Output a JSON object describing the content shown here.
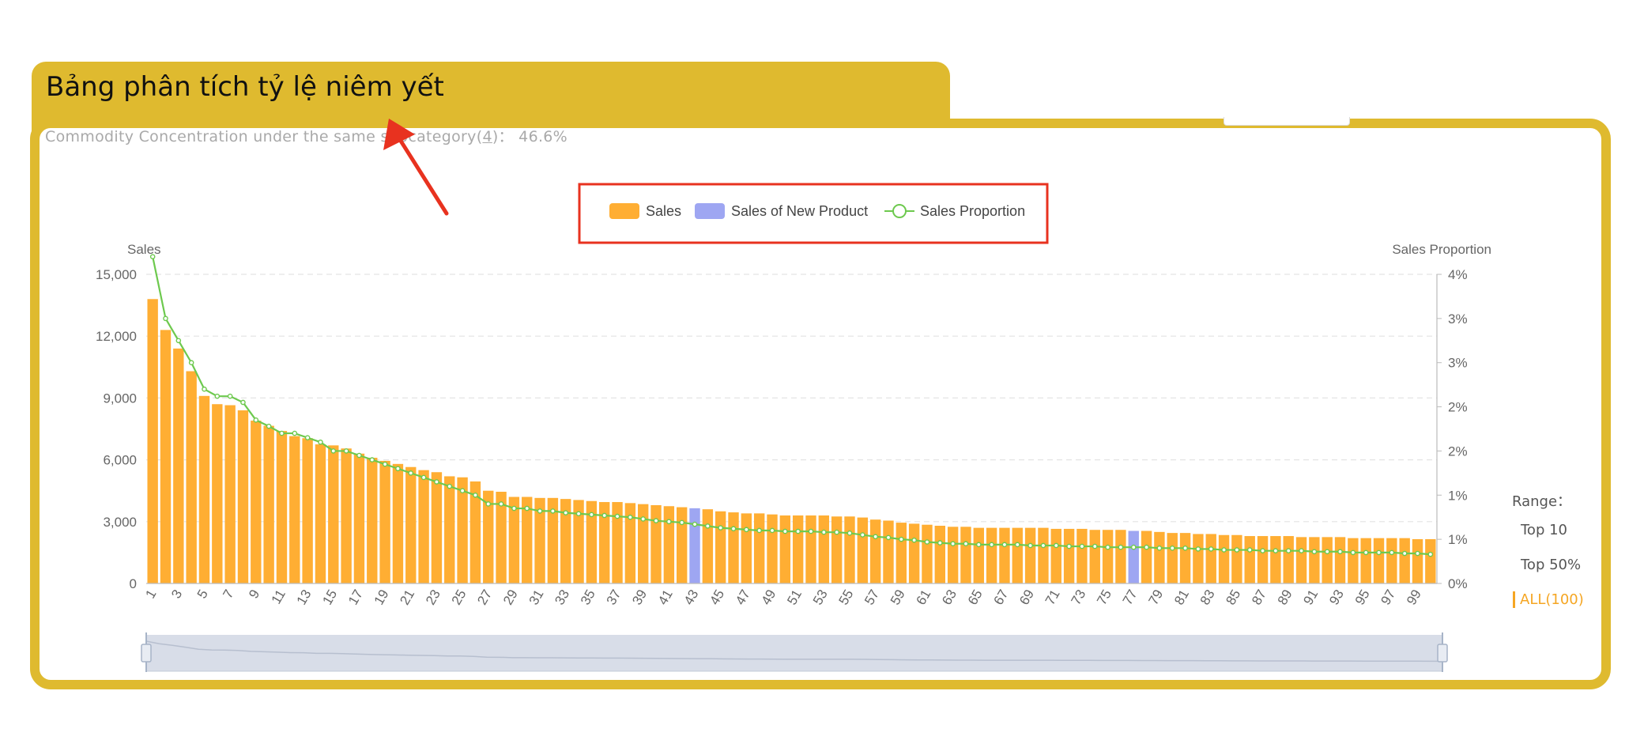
{
  "header": {
    "title": "Bảng phân tích tỷ lệ niêm yết",
    "subtitle_prefix": "Commodity Concentration under the same subcategory(",
    "subtitle_count": "4",
    "subtitle_suffix": ")：  46.6%"
  },
  "range": {
    "label": "Range：",
    "options": [
      "Top 10",
      "Top 50%",
      "ALL(100)"
    ],
    "active": "ALL(100)"
  },
  "colors": {
    "sales": "#ffae33",
    "new_product": "#9ea6f2",
    "proportion": "#6dc94e",
    "annotation": "#e8321f",
    "accent": "#dfba2f"
  },
  "chart_data": {
    "type": "bar",
    "legend": [
      "Sales",
      "Sales of New Product",
      "Sales Proportion"
    ],
    "ylabel_left": "Sales",
    "ylabel_right": "Sales Proportion",
    "yticks_left": [
      "0",
      "3,000",
      "6,000",
      "9,000",
      "12,000",
      "15,000"
    ],
    "yticks_right": [
      "0%",
      "1%",
      "1%",
      "2%",
      "2%",
      "3%",
      "3%",
      "4%"
    ],
    "ylim_left": [
      0,
      15000
    ],
    "ylim_right": [
      0,
      3.5
    ],
    "x_tick_labels": [
      "1",
      "3",
      "5",
      "7",
      "9",
      "11",
      "13",
      "15",
      "17",
      "19",
      "21",
      "23",
      "25",
      "27",
      "29",
      "31",
      "33",
      "35",
      "37",
      "39",
      "41",
      "43",
      "45",
      "47",
      "49",
      "51",
      "53",
      "55",
      "57",
      "59",
      "61",
      "63",
      "65",
      "67",
      "69",
      "71",
      "73",
      "75",
      "77",
      "79",
      "81",
      "83",
      "85",
      "87",
      "89",
      "91",
      "93",
      "95",
      "97",
      "99"
    ],
    "new_product_ranks": [
      43,
      77
    ],
    "sales": [
      13800,
      12300,
      11400,
      10300,
      9100,
      8700,
      8650,
      8400,
      7900,
      7650,
      7400,
      7150,
      7050,
      6750,
      6700,
      6550,
      6300,
      6100,
      5950,
      5800,
      5650,
      5500,
      5400,
      5200,
      5150,
      4950,
      4500,
      4450,
      4200,
      4200,
      4150,
      4150,
      4100,
      4050,
      4000,
      3950,
      3950,
      3900,
      3850,
      3800,
      3750,
      3700,
      3650,
      3600,
      3500,
      3450,
      3400,
      3400,
      3350,
      3300,
      3300,
      3300,
      3300,
      3250,
      3250,
      3200,
      3100,
      3050,
      2950,
      2900,
      2850,
      2800,
      2750,
      2750,
      2700,
      2700,
      2700,
      2700,
      2700,
      2700,
      2650,
      2650,
      2650,
      2600,
      2600,
      2600,
      2550,
      2550,
      2500,
      2450,
      2450,
      2400,
      2400,
      2350,
      2350,
      2300,
      2300,
      2300,
      2300,
      2250,
      2250,
      2250,
      2250,
      2200,
      2200,
      2200,
      2200,
      2200,
      2150,
      2150
    ],
    "proportion": [
      3.7,
      3.0,
      2.75,
      2.5,
      2.2,
      2.12,
      2.12,
      2.05,
      1.85,
      1.78,
      1.7,
      1.7,
      1.65,
      1.6,
      1.5,
      1.5,
      1.45,
      1.4,
      1.35,
      1.3,
      1.25,
      1.2,
      1.15,
      1.1,
      1.05,
      1.0,
      0.9,
      0.9,
      0.85,
      0.85,
      0.82,
      0.82,
      0.8,
      0.79,
      0.78,
      0.77,
      0.76,
      0.75,
      0.73,
      0.71,
      0.7,
      0.69,
      0.67,
      0.65,
      0.63,
      0.62,
      0.61,
      0.6,
      0.6,
      0.59,
      0.59,
      0.59,
      0.58,
      0.58,
      0.57,
      0.55,
      0.53,
      0.52,
      0.5,
      0.49,
      0.47,
      0.46,
      0.45,
      0.45,
      0.44,
      0.44,
      0.44,
      0.44,
      0.43,
      0.43,
      0.43,
      0.42,
      0.42,
      0.42,
      0.41,
      0.41,
      0.41,
      0.41,
      0.4,
      0.4,
      0.4,
      0.39,
      0.39,
      0.38,
      0.38,
      0.38,
      0.37,
      0.37,
      0.37,
      0.37,
      0.36,
      0.36,
      0.36,
      0.35,
      0.35,
      0.35,
      0.35,
      0.34,
      0.34,
      0.33
    ],
    "grid": true,
    "legend_position": "top-center"
  }
}
